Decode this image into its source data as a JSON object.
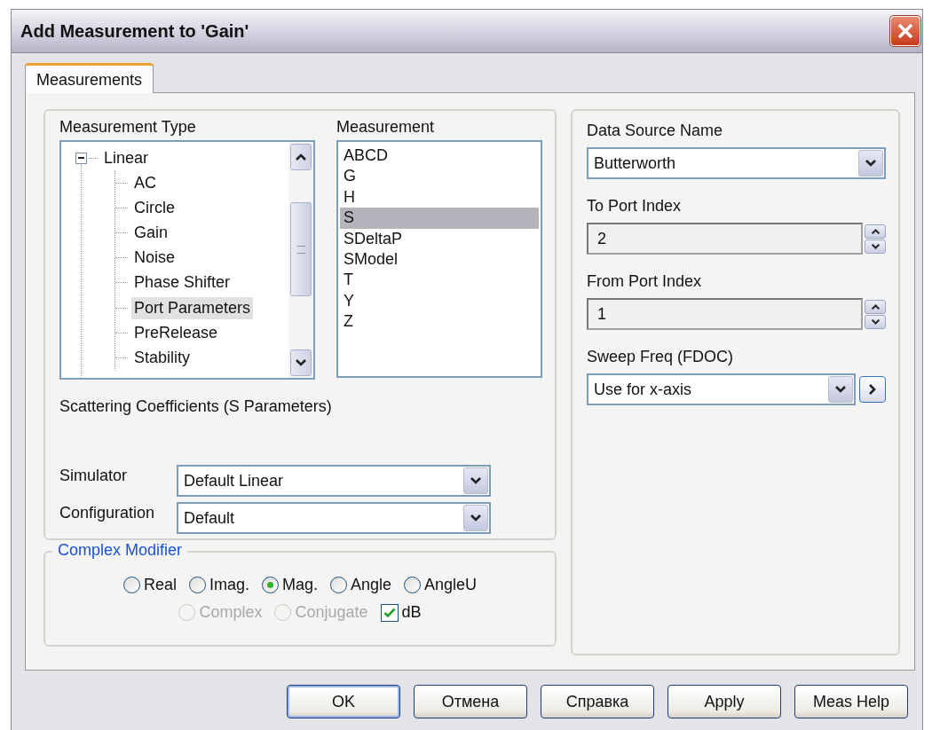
{
  "window": {
    "title": "Add Measurement to 'Gain'"
  },
  "tabs": [
    {
      "label": "Measurements",
      "selected": true
    }
  ],
  "measurement_type": {
    "label": "Measurement Type",
    "tree": [
      {
        "label": "Linear",
        "expanded": true,
        "selected": false,
        "children": [
          {
            "label": "AC",
            "selected": false
          },
          {
            "label": "Circle",
            "selected": false
          },
          {
            "label": "Gain",
            "selected": false
          },
          {
            "label": "Noise",
            "selected": false
          },
          {
            "label": "Phase Shifter",
            "selected": false
          },
          {
            "label": "Port Parameters",
            "selected": true
          },
          {
            "label": "PreRelease",
            "selected": false
          },
          {
            "label": "Stability",
            "selected": false
          }
        ]
      }
    ]
  },
  "measurement": {
    "label": "Measurement",
    "items": [
      {
        "label": "ABCD",
        "selected": false
      },
      {
        "label": "G",
        "selected": false
      },
      {
        "label": "H",
        "selected": false
      },
      {
        "label": "S",
        "selected": true
      },
      {
        "label": "SDeltaP",
        "selected": false
      },
      {
        "label": "SModel",
        "selected": false
      },
      {
        "label": "T",
        "selected": false
      },
      {
        "label": "Y",
        "selected": false
      },
      {
        "label": "Z",
        "selected": false
      }
    ]
  },
  "description": "Scattering Coefficients (S Parameters)",
  "simulator": {
    "label": "Simulator",
    "value": "Default Linear"
  },
  "configuration": {
    "label": "Configuration",
    "value": "Default"
  },
  "complex_modifier": {
    "title": "Complex Modifier",
    "options": [
      {
        "kind": "radio",
        "label": "Real",
        "selected": false,
        "disabled": false
      },
      {
        "kind": "radio",
        "label": "Imag.",
        "selected": false,
        "disabled": false
      },
      {
        "kind": "radio",
        "label": "Mag.",
        "selected": true,
        "disabled": false
      },
      {
        "kind": "radio",
        "label": "Angle",
        "selected": false,
        "disabled": false
      },
      {
        "kind": "radio",
        "label": "AngleU",
        "selected": false,
        "disabled": false
      },
      {
        "kind": "radio",
        "label": "Complex",
        "selected": false,
        "disabled": true
      },
      {
        "kind": "radio",
        "label": "Conjugate",
        "selected": false,
        "disabled": true
      },
      {
        "kind": "checkbox",
        "label": "dB",
        "checked": true,
        "disabled": false
      }
    ]
  },
  "data_source": {
    "label": "Data Source Name",
    "value": "Butterworth"
  },
  "to_port": {
    "label": "To Port Index",
    "value": "2"
  },
  "from_port": {
    "label": "From Port Index",
    "value": "1"
  },
  "sweep": {
    "label": "Sweep Freq (FDOC)",
    "value": "Use for x-axis"
  },
  "buttons": [
    {
      "label": "OK",
      "default": true
    },
    {
      "label": "Отмена",
      "default": false
    },
    {
      "label": "Справка",
      "default": false
    },
    {
      "label": "Apply",
      "default": false
    },
    {
      "label": "Meas Help",
      "default": false
    }
  ]
}
